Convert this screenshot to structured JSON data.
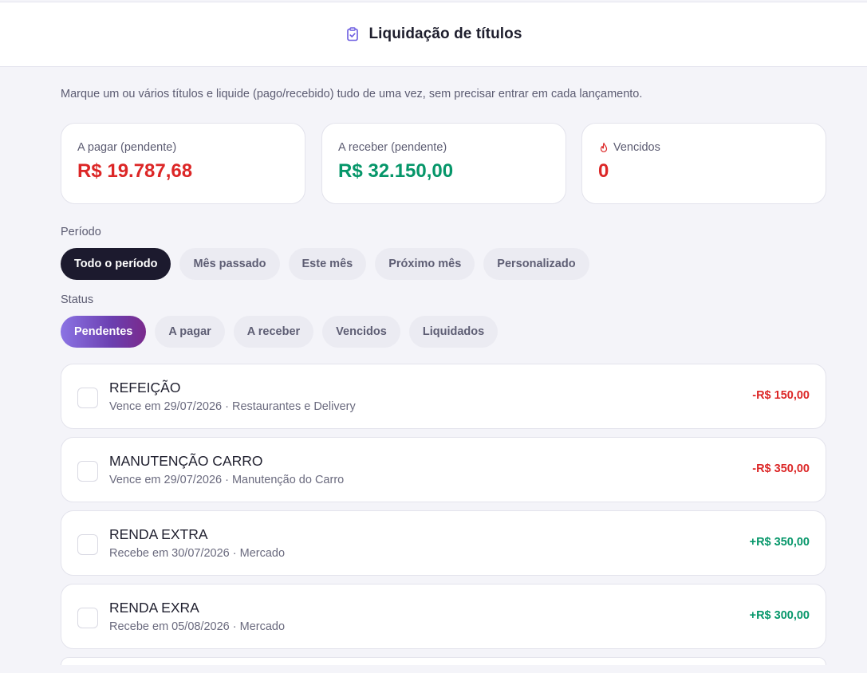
{
  "header": {
    "title": "Liquidação de títulos",
    "icon": "clipboard-check-icon"
  },
  "intro": "Marque um ou vários títulos e liquide (pago/recebido) tudo de uma vez, sem precisar entrar em cada lançamento.",
  "summary": {
    "payable_label": "A pagar (pendente)",
    "payable_value": "R$ 19.787,68",
    "receivable_label": "A receber (pendente)",
    "receivable_value": "R$ 32.150,00",
    "overdue_label": "Vencidos",
    "overdue_icon": "flame-icon",
    "overdue_value": "0"
  },
  "period": {
    "label": "Período",
    "options": [
      "Todo o período",
      "Mês passado",
      "Este mês",
      "Próximo mês",
      "Personalizado"
    ],
    "selected": "Todo o período"
  },
  "status": {
    "label": "Status",
    "options": [
      "Pendentes",
      "A pagar",
      "A receber",
      "Vencidos",
      "Liquidados"
    ],
    "selected": "Pendentes"
  },
  "titles": [
    {
      "name": "REFEIÇÃO",
      "sub": "Vence em 29/07/2026 · Restaurantes e Delivery",
      "amount": "-R$ 150,00"
    },
    {
      "name": "MANUTENÇÃO CARRO",
      "sub": "Vence em 29/07/2026 · Manutenção do Carro",
      "amount": "-R$ 350,00"
    },
    {
      "name": "RENDA EXTRA",
      "sub": "Recebe em 30/07/2026 · Mercado",
      "amount": "+R$ 350,00"
    },
    {
      "name": "RENDA EXRA",
      "sub": "Recebe em 05/08/2026 · Mercado",
      "amount": "+R$ 300,00"
    }
  ],
  "colors": {
    "negative": "#dc2626",
    "positive": "#059669",
    "accent": "#6b5be0"
  }
}
